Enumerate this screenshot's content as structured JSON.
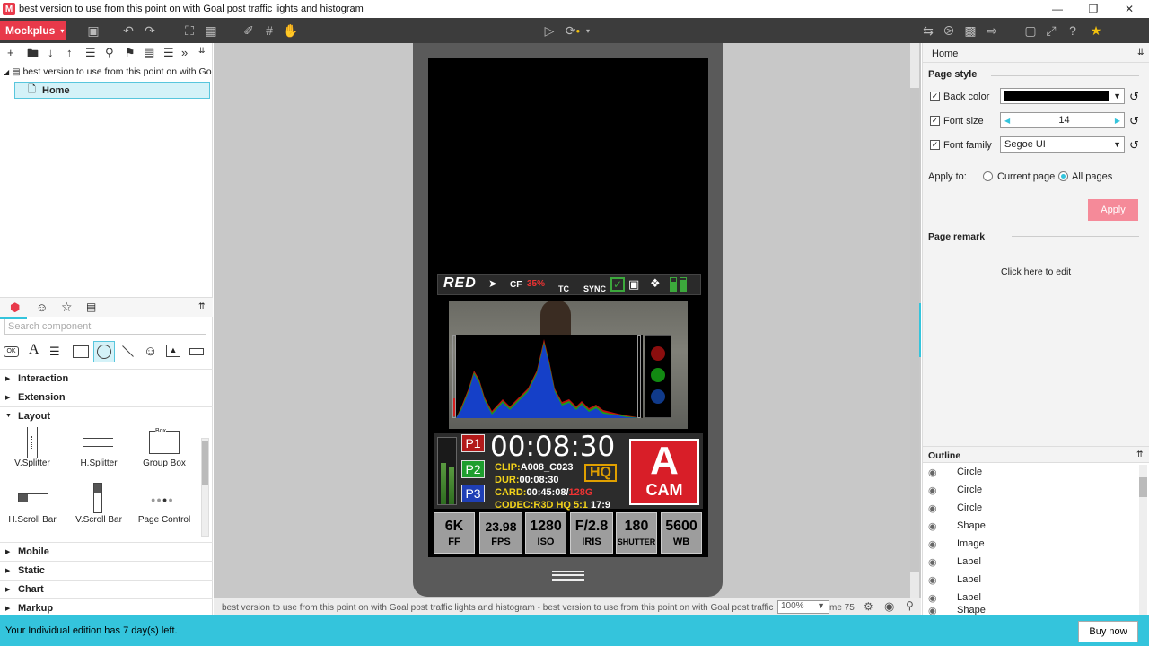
{
  "window": {
    "title": "best version to use from this point on with Goal post traffic lights and histogram",
    "app_icon": "M"
  },
  "toolbar": {
    "brand": "Mockplus"
  },
  "left": {
    "tree_root": "best version to use from this point on with Goal post traffic lights and histogram",
    "tree_home": "Home",
    "search_placeholder": "Search component",
    "categories": [
      "Interaction",
      "Extension",
      "Layout",
      "Mobile",
      "Static",
      "Chart",
      "Markup"
    ],
    "components": [
      "V.Splitter",
      "H.Splitter",
      "Group Box",
      "H.Scroll Bar",
      "V.Scroll Bar",
      "Page Control"
    ],
    "groupbox_caption": "Box",
    "ok_label": "OK",
    "text_icon": "A"
  },
  "camera": {
    "brand": "RED",
    "cf": "CF",
    "cf_pct": "35%",
    "tc": "TC",
    "sync": "SYNC",
    "p1": "P1",
    "p2": "P2",
    "p3": "P3",
    "timecode": "00:08:30",
    "clip_label": "CLIP:",
    "clip": "A008_C023",
    "hq": "HQ",
    "dur_label": "DUR:",
    "dur": "00:08:30",
    "card_label": "CARD:",
    "card": "00:45:08/",
    "card_cap": "128G",
    "codec_label": "CODEC:",
    "codec": "R3D HQ 5:1",
    "ratio": "17:9",
    "cam_letter": "A",
    "cam_word": "CAM",
    "stats": [
      {
        "v": "6K",
        "l": "FF"
      },
      {
        "v": "23.98",
        "l": "FPS"
      },
      {
        "v": "1280",
        "l": "ISO"
      },
      {
        "v": "F/2.8",
        "l": "IRIS"
      },
      {
        "v": "180",
        "l": "SHUTTER"
      },
      {
        "v": "5600",
        "l": "WB"
      }
    ]
  },
  "statusbar": {
    "text": "best version to use from this point on with Goal post traffic lights and histogram - best version to use from this point on with Goal post traffic lights and h",
    "zoom": "100%",
    "tail": "me 75"
  },
  "right": {
    "header": "Home",
    "page_style": "Page style",
    "back_color_label": "Back color",
    "back_color_value": "#000000",
    "font_size_label": "Font size",
    "font_size_value": "14",
    "font_family_label": "Font family",
    "font_family_value": "Segoe UI",
    "apply_to": "Apply to:",
    "current_page": "Current page",
    "all_pages": "All pages",
    "apply_button": "Apply",
    "page_remark": "Page remark",
    "click_to_edit": "Click here to edit",
    "outline_title": "Outline",
    "outline_items": [
      "Circle",
      "Circle",
      "Circle",
      "Shape",
      "Image",
      "Label",
      "Label",
      "Label",
      "Shape"
    ]
  },
  "bottom": {
    "notice": "Your Individual edition has 7 day(s) left.",
    "buy": "Buy now"
  },
  "colors": {
    "accent": "#e8394a",
    "cyan": "#34c4dc",
    "toolbar": "#3c3c3c",
    "apply": "#f58a99"
  }
}
